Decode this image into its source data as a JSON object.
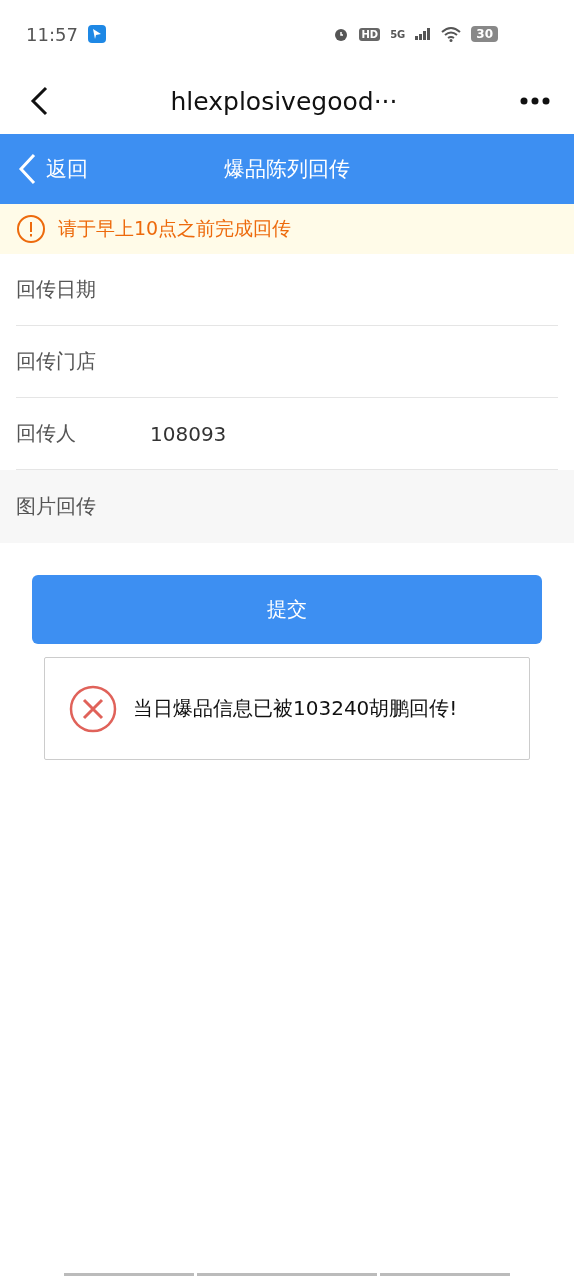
{
  "status_bar": {
    "time": "11:57",
    "network": "5G",
    "hd": "HD",
    "battery": "30"
  },
  "browser_bar": {
    "title": "hlexplosivegood···"
  },
  "header": {
    "back": "返回",
    "title": "爆品陈列回传"
  },
  "notice": {
    "text": "请于早上10点之前完成回传"
  },
  "form": [
    {
      "kind": "field",
      "label": "回传日期"
    },
    {
      "kind": "field",
      "label": "回传门店"
    },
    {
      "kind": "field",
      "label": "回传人",
      "value": "108093"
    },
    {
      "kind": "section",
      "label": "图片回传"
    }
  ],
  "submit": "提交",
  "toast": {
    "kind": "error",
    "text": "当日爆品信息已被103240胡鹏回传!"
  }
}
